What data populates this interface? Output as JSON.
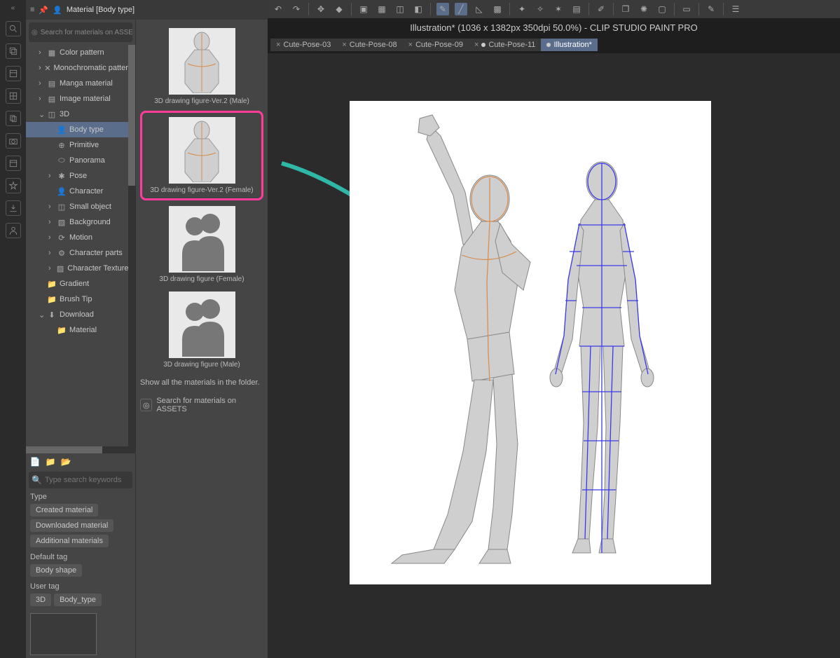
{
  "panel": {
    "title": "Material [Body type]"
  },
  "assets_search_placeholder": "Search for materials on ASSETS",
  "tree": {
    "items": [
      {
        "label": "Color pattern",
        "icon": "grid",
        "indent": 1,
        "caret": ">"
      },
      {
        "label": "Monochromatic pattern",
        "icon": "x",
        "indent": 1,
        "caret": ">"
      },
      {
        "label": "Manga material",
        "icon": "page",
        "indent": 1,
        "caret": ">"
      },
      {
        "label": "Image material",
        "icon": "page",
        "indent": 1,
        "caret": ">"
      },
      {
        "label": "3D",
        "icon": "cube",
        "indent": 1,
        "caret": "v"
      },
      {
        "label": "Body type",
        "icon": "person",
        "indent": 2,
        "caret": "",
        "selected": true
      },
      {
        "label": "Primitive",
        "icon": "globe",
        "indent": 2,
        "caret": ""
      },
      {
        "label": "Panorama",
        "icon": "pano",
        "indent": 2,
        "caret": ""
      },
      {
        "label": "Pose",
        "icon": "pose",
        "indent": 2,
        "caret": ">"
      },
      {
        "label": "Character",
        "icon": "person",
        "indent": 2,
        "caret": ""
      },
      {
        "label": "Small object",
        "icon": "cube",
        "indent": 2,
        "caret": ">"
      },
      {
        "label": "Background",
        "icon": "bg",
        "indent": 2,
        "caret": ">"
      },
      {
        "label": "Motion",
        "icon": "motion",
        "indent": 2,
        "caret": ">"
      },
      {
        "label": "Character parts",
        "icon": "parts",
        "indent": 2,
        "caret": ">"
      },
      {
        "label": "Character Textures",
        "icon": "tex",
        "indent": 2,
        "caret": ">"
      },
      {
        "label": "Gradient",
        "icon": "folder",
        "indent": 1,
        "caret": ""
      },
      {
        "label": "Brush Tip",
        "icon": "folder",
        "indent": 1,
        "caret": ""
      },
      {
        "label": "Download",
        "icon": "dl",
        "indent": 1,
        "caret": "v"
      },
      {
        "label": "Material",
        "icon": "folder",
        "indent": 2,
        "caret": ""
      }
    ]
  },
  "kw_placeholder": "Type search keywords",
  "filters": {
    "type_label": "Type",
    "type_chips": [
      "Created material",
      "Downloaded material",
      "Additional materials"
    ],
    "default_label": "Default tag",
    "default_chips": [
      "Body shape"
    ],
    "user_label": "User tag",
    "user_chips": [
      "3D",
      "Body_type"
    ]
  },
  "thumbs": [
    {
      "label": "3D drawing figure-Ver.2 (Male)",
      "kind": "torso",
      "highlighted": false
    },
    {
      "label": "3D drawing figure-Ver.2 (Female)",
      "kind": "torso",
      "highlighted": true
    },
    {
      "label": "3D drawing figure (Female)",
      "kind": "silh",
      "highlighted": false
    },
    {
      "label": "3D drawing figure (Male)",
      "kind": "silh",
      "highlighted": false
    }
  ],
  "show_all_text": "Show all the materials in the folder.",
  "assets_row_text": "Search for materials on ASSETS",
  "titlebar": "Illustration* (1036 x 1382px 350dpi 50.0%)  - CLIP STUDIO PAINT PRO",
  "tabs": [
    {
      "label": "Cute-Pose-03",
      "close": true,
      "active": false
    },
    {
      "label": "Cute-Pose-08",
      "close": true,
      "active": false
    },
    {
      "label": "Cute-Pose-09",
      "close": true,
      "active": false
    },
    {
      "label": "Cute-Pose-11",
      "close": true,
      "active": false,
      "dot": true
    },
    {
      "label": "Illustration*",
      "close": false,
      "active": true,
      "dot": true
    }
  ]
}
